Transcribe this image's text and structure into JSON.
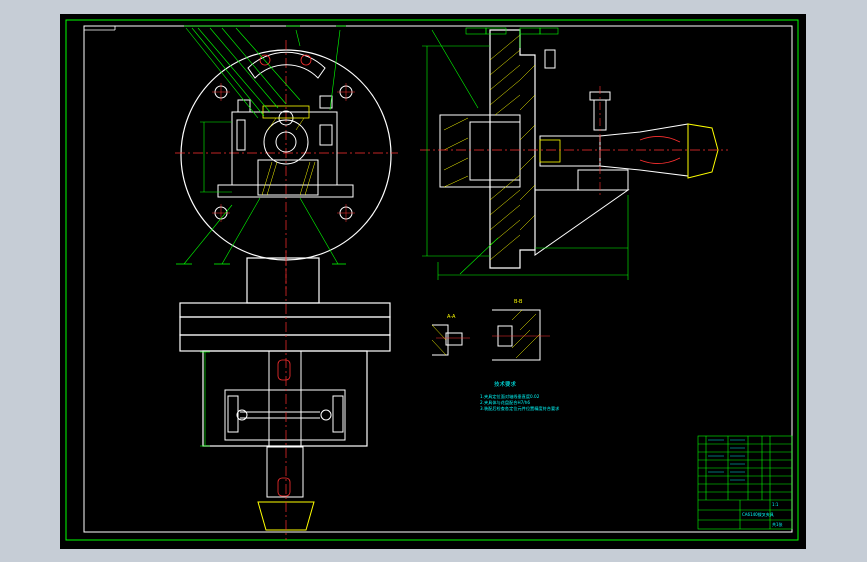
{
  "section_labels": {
    "a_label": "A-A",
    "b_label": "B-B"
  },
  "tech_requirements": {
    "title": "技术要求",
    "lines": [
      "1.夹具定位面对轴线垂直度0.02",
      "2.夹具体与花盘配合H7/h6",
      "3.装配后检查各定位元件位置精度符合要求"
    ]
  },
  "title_block": {
    "drawing_title": "CA6140拨叉夹具",
    "scale": "1:1",
    "sheet": "共1张"
  },
  "colors": {
    "sheet_bg": "#000000",
    "window_bg": "#c6cdd6",
    "outline": "#ffffff",
    "centerline": "#ff3030",
    "dimension": "#00ff00",
    "hatch": "#ffff00",
    "annotation": "#00ffff"
  }
}
